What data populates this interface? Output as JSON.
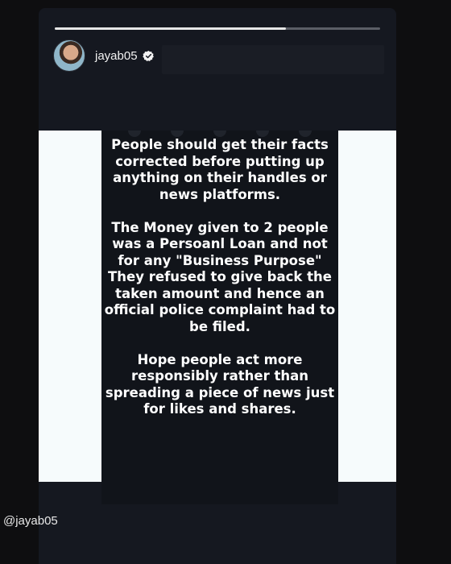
{
  "story": {
    "username": "jayab05",
    "progress_fraction": 0.71,
    "paragraphs": [
      "People should get their facts corrected before putting up anything on their handles or news platforms.",
      "The Money given to 2 people was a Persoanl Loan and not for any \"Business Purpose\" They refused to give back the taken amount and hence an official police complaint had to be filed.",
      "Hope people act more responsibly rather than spreading a piece of news just for likes and shares."
    ]
  },
  "footer": {
    "handle": "@jayab05"
  },
  "icons": {
    "verified": "verified-badge-icon",
    "avatar": "profile-avatar"
  },
  "colors": {
    "background": "#0e0e10",
    "card": "#151820",
    "panel": "#11141a",
    "side": "#f6fbfc",
    "progress": "#e6e6e6"
  }
}
